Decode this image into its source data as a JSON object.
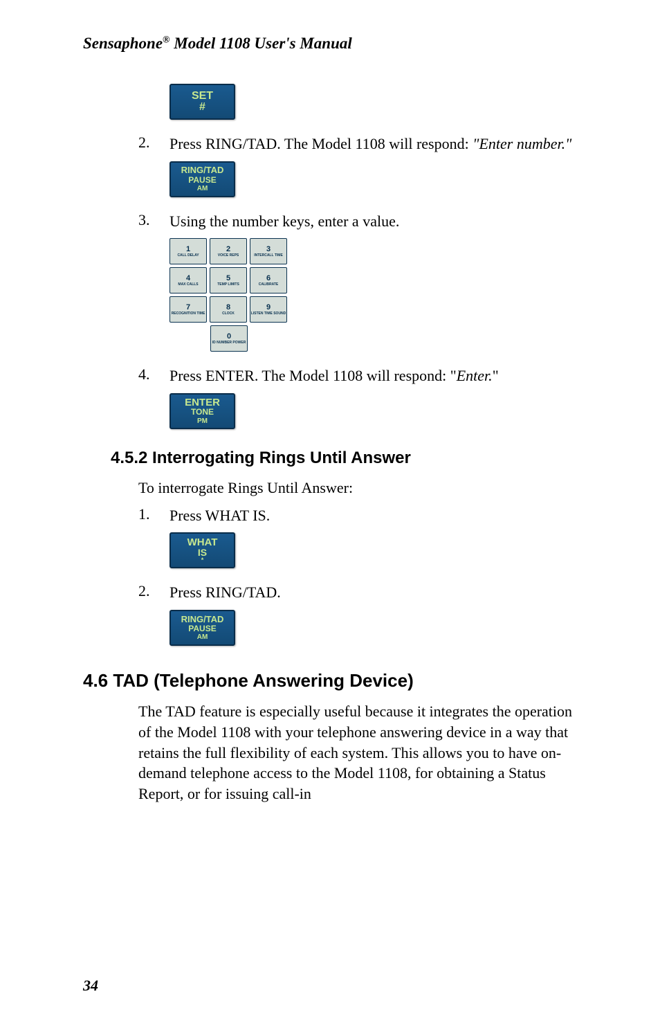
{
  "header": {
    "prefix": "Sensaphone",
    "suffix": " Model 1108 User's Manual"
  },
  "steps_top": [
    {
      "num": "2.",
      "text_pre": "Press RING/TAD. The Model 1108 will respond: ",
      "text_italic": "\"Enter number.\""
    },
    {
      "num": "3.",
      "text": "Using the number keys, enter a value."
    },
    {
      "num": "4.",
      "text_pre": "Press ENTER. The Model 1108 will respond: \"",
      "text_italic": "Enter.",
      "text_post": "\""
    }
  ],
  "section_452": {
    "heading": "4.5.2  Interrogating Rings Until Answer",
    "intro": "To interrogate Rings Until Answer:",
    "steps": [
      {
        "num": "1.",
        "text": "Press WHAT IS."
      },
      {
        "num": "2.",
        "text": "Press RING/TAD."
      }
    ]
  },
  "section_46": {
    "heading": "4.6   TAD (Telephone Answering  Device)",
    "body": "The TAD feature is especially useful because it integrates the operation of the Model 1108 with your telephone answering device in a way that retains the full flexibility of each system. This allows you to have on-demand telephone access to the Model 1108, for obtaining a Status Report, or for issuing call-in"
  },
  "buttons": {
    "set": {
      "line1": "SET",
      "line2": "#"
    },
    "ring_tad": {
      "line1": "RING/TAD",
      "line2": "PAUSE",
      "line3": "AM"
    },
    "enter": {
      "line1": "ENTER",
      "line2": "TONE",
      "line3": "PM"
    },
    "what_is": {
      "line1": "WHAT",
      "line2": "IS",
      "line3": "*"
    }
  },
  "keypad": [
    [
      {
        "n": "1",
        "l": "CALL\nDELAY"
      },
      {
        "n": "2",
        "l": "VOICE\nREPS"
      },
      {
        "n": "3",
        "l": "INTERCALL\nTIME"
      }
    ],
    [
      {
        "n": "4",
        "l": "MAX CALLS"
      },
      {
        "n": "5",
        "l": "TEMP LIMITS"
      },
      {
        "n": "6",
        "l": "CALIBRATE"
      }
    ],
    [
      {
        "n": "7",
        "l": "RECOGNITION\nTIME"
      },
      {
        "n": "8",
        "l": "CLOCK"
      },
      {
        "n": "9",
        "l": "LISTEN TIME\nSOUND"
      }
    ],
    [
      {
        "n": "0",
        "l": "ID NUMBER\nPOWER"
      }
    ]
  ],
  "page_number": "34"
}
